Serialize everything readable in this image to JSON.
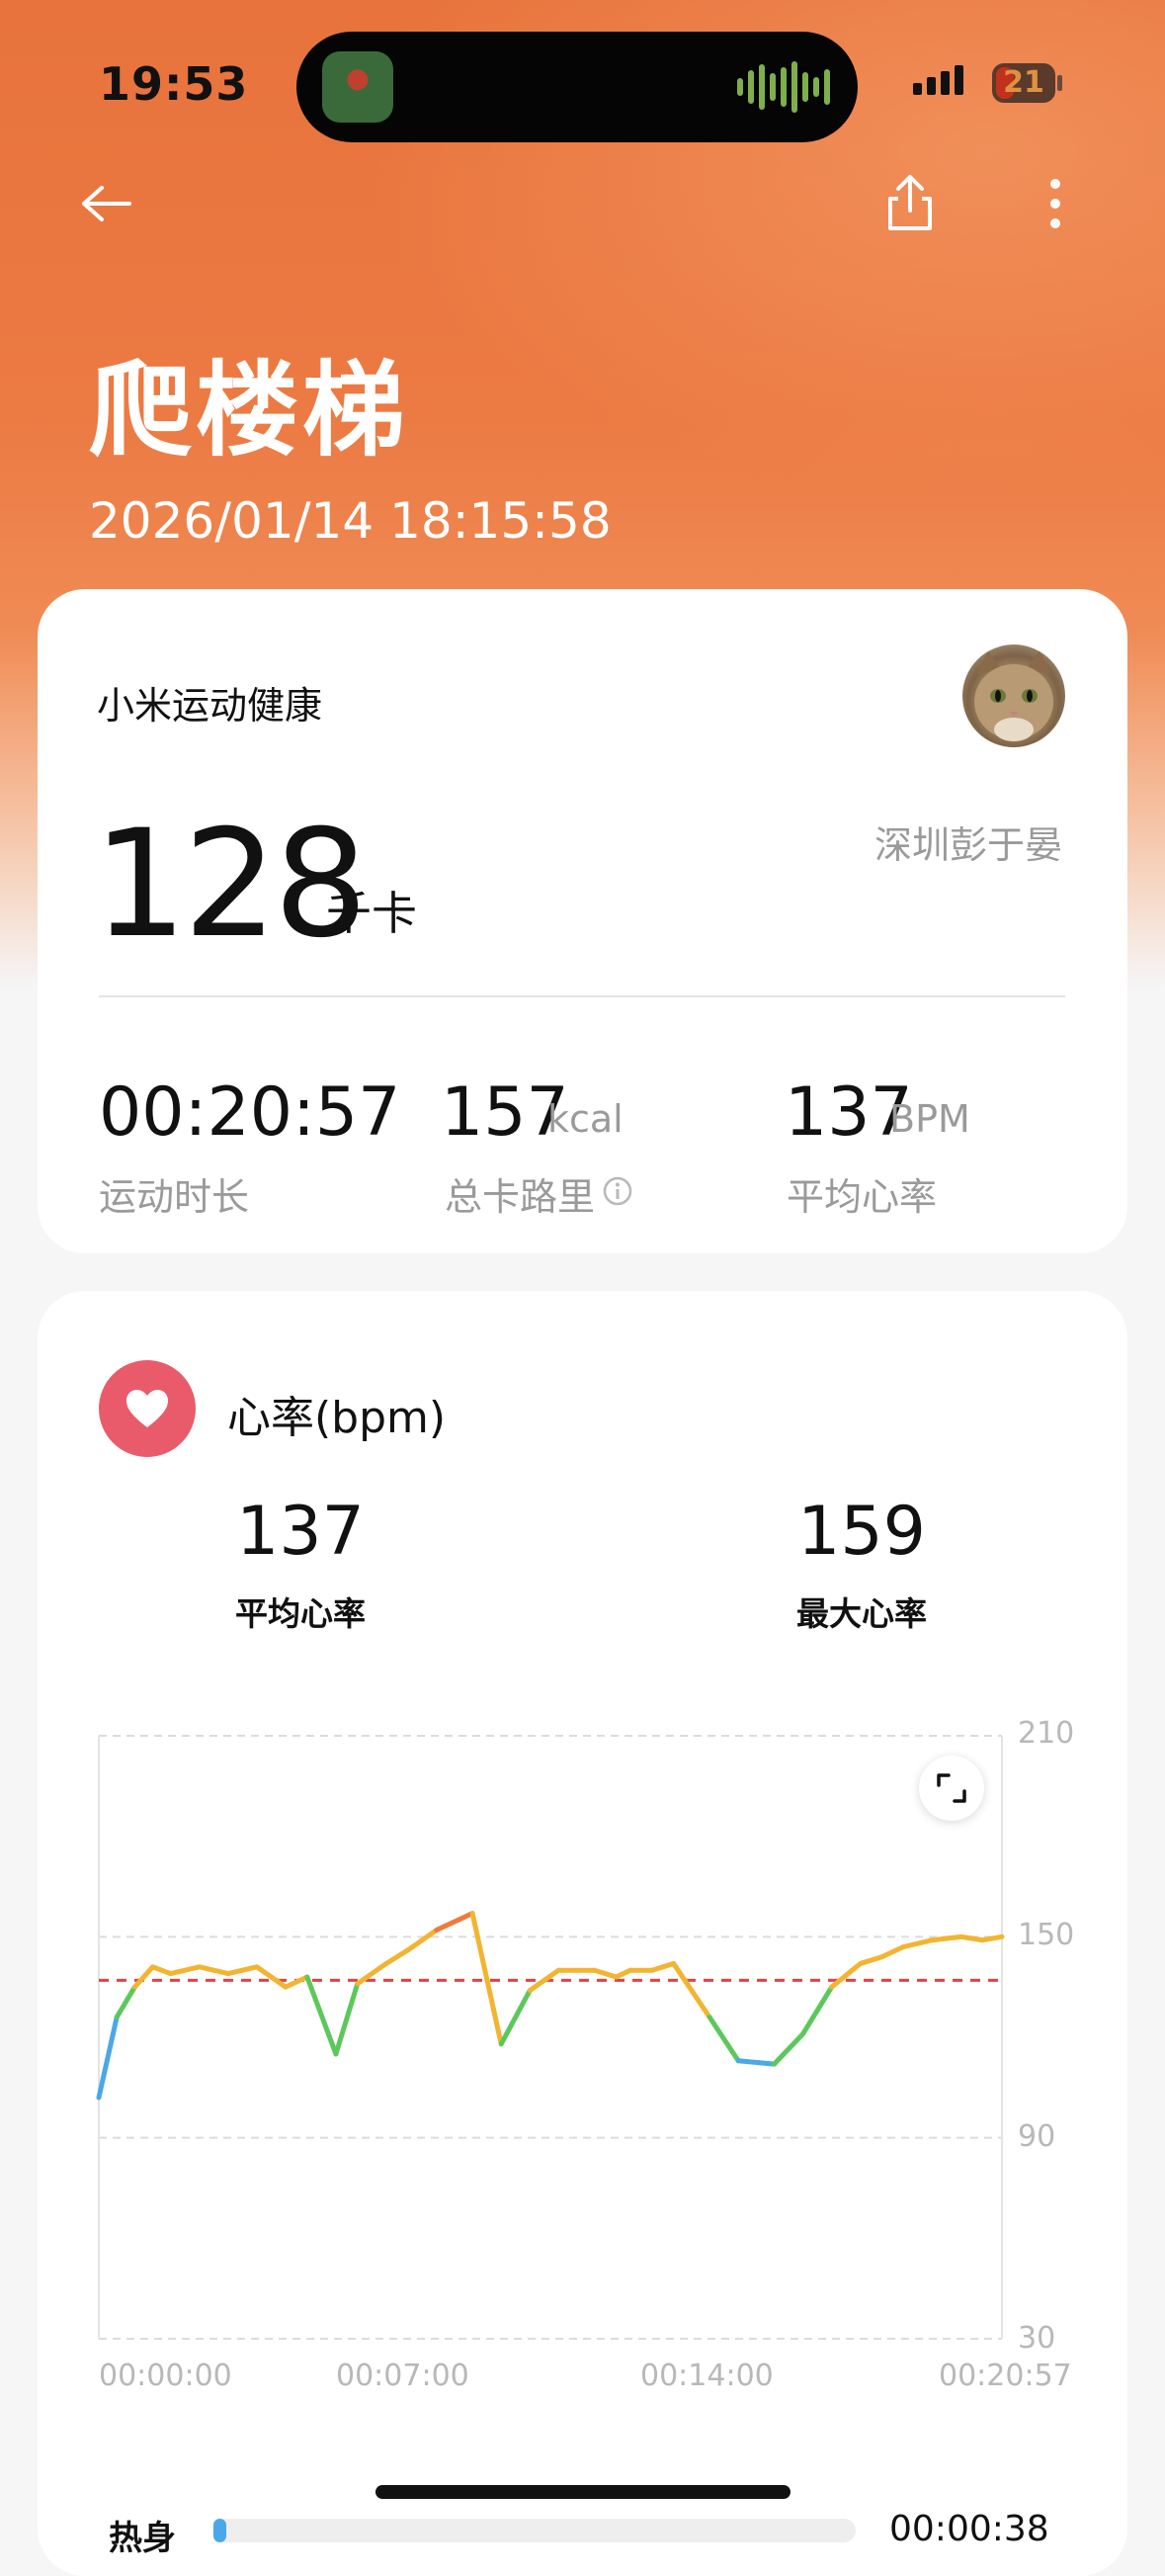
{
  "status_bar": {
    "time": "19:53",
    "battery": "21"
  },
  "header": {
    "title": "爬楼梯",
    "datetime": "2026/01/14 18:15:58"
  },
  "summary": {
    "brand": "小米运动健康",
    "location": "深圳彭于晏",
    "active_kcal": "128",
    "active_kcal_unit": "千卡",
    "stats": [
      {
        "value": "00:20:57",
        "unit": "",
        "label": "运动时长"
      },
      {
        "value": "157",
        "unit": "kcal",
        "label": "总卡路里"
      },
      {
        "value": "137",
        "unit": "BPM",
        "label": "平均心率"
      }
    ]
  },
  "heart_rate": {
    "title": "心率(bpm)",
    "avg_value": "137",
    "avg_label": "平均心率",
    "max_value": "159",
    "max_label": "最大心率"
  },
  "chart_data": {
    "type": "line",
    "title": "心率(bpm)",
    "xlabel": "",
    "ylabel": "",
    "x_ticks": [
      "00:00:00",
      "00:07:00",
      "00:14:00",
      "00:20:57"
    ],
    "y_ticks": [
      "210",
      "150",
      "90",
      "30"
    ],
    "ylim": [
      30,
      210
    ],
    "xlim_seconds": [
      0,
      1257
    ],
    "average_line": 137,
    "grid": true,
    "colors": {
      "low": "#4aa8e8",
      "mid": "#5cc85c",
      "high": "#f2b431",
      "peak": "#ee7a3c",
      "avg_line": "#e84040"
    },
    "series": [
      {
        "x_seconds": [
          0,
          25,
          50,
          75,
          100,
          140,
          180,
          220,
          260,
          290,
          330,
          360,
          400,
          430,
          470,
          520,
          560,
          600,
          640,
          690,
          720,
          740,
          770,
          800,
          850,
          890,
          940,
          980,
          1020,
          1060,
          1090,
          1120,
          1160,
          1200,
          1230,
          1257
        ],
        "values": [
          102,
          126,
          135,
          141,
          139,
          141,
          139,
          141,
          135,
          138,
          115,
          136,
          142,
          146,
          152,
          157,
          118,
          134,
          140,
          140,
          138,
          140,
          140,
          142,
          126,
          113,
          112,
          121,
          135,
          142,
          144,
          147,
          149,
          150,
          149,
          150
        ]
      }
    ]
  },
  "zone": {
    "label": "热身",
    "time": "00:00:38",
    "fill_fraction": 0.02
  },
  "icons": {
    "back": "back-arrow-icon",
    "share": "share-icon",
    "more": "more-icon",
    "heart": "heart-icon",
    "expand": "expand-icon",
    "info": "info-icon"
  }
}
